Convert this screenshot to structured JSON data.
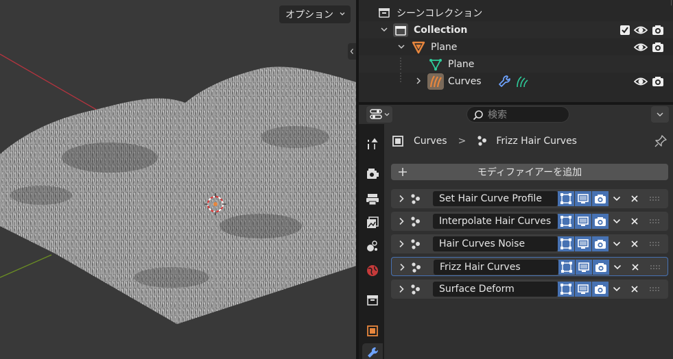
{
  "viewport": {
    "options_label": "オプション",
    "side_toggle_icon": "chevron-left-icon"
  },
  "outliner": {
    "rows": [
      {
        "label": "シーンコレクション",
        "icon": "scene-collection-icon"
      },
      {
        "label": "Collection",
        "icon": "collection-icon",
        "checked": true
      },
      {
        "label": "Plane",
        "icon": "object-mesh-icon"
      },
      {
        "label": "Plane",
        "icon": "mesh-data-icon"
      },
      {
        "label": "Curves",
        "icon": "curves-object-icon",
        "modifier_icons": [
          "wrench-icon",
          "hair-icon"
        ]
      }
    ]
  },
  "properties": {
    "search_placeholder": "検索",
    "breadcrumb": {
      "object": "Curves",
      "separator": ">",
      "modifier": "Frizz Hair Curves"
    },
    "add_modifier_label": "モディファイアーを追加",
    "modifiers": [
      {
        "name": "Set Hair Curve Profile",
        "selected": false
      },
      {
        "name": "Interpolate Hair Curves",
        "selected": false
      },
      {
        "name": "Hair Curves Noise",
        "selected": false
      },
      {
        "name": "Frizz Hair Curves",
        "selected": true
      },
      {
        "name": "Surface Deform",
        "selected": false
      }
    ],
    "tabs": [
      "tool-icon",
      "render-icon",
      "output-icon",
      "view-layer-icon",
      "scene-icon",
      "world-icon",
      "collection-icon",
      "object-icon",
      "modifier-icon"
    ],
    "active_tab": "modifier-icon"
  },
  "colors": {
    "accent": "#4772b3",
    "object_orange": "#e7863d",
    "mesh_green": "#2ecc9b",
    "modifier_blue": "#6ea3ff"
  }
}
